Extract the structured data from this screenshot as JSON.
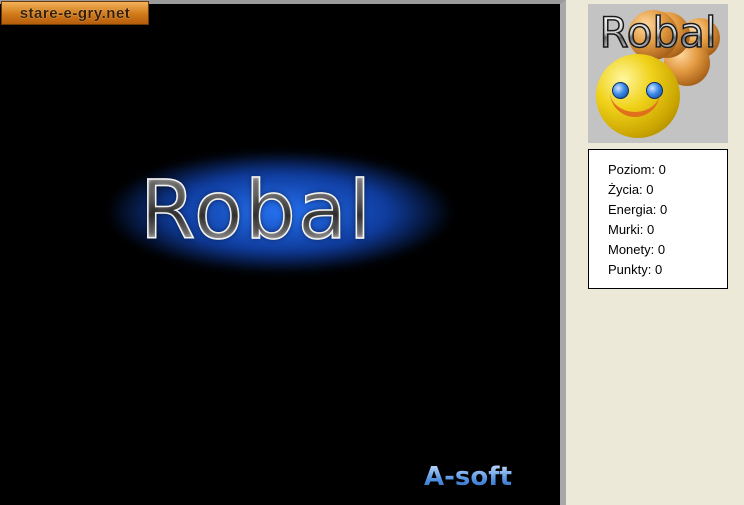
{
  "watermark": {
    "text": "stare-e-gry.net"
  },
  "title_screen": {
    "title": "Robal",
    "publisher": "A-soft"
  },
  "logo": {
    "text": "Robal",
    "mascot": "smiley-worm-icon"
  },
  "stats": [
    {
      "label": "Poziom:",
      "value": "0"
    },
    {
      "label": "Życia:",
      "value": "0"
    },
    {
      "label": "Energia:",
      "value": "0"
    },
    {
      "label": "Murki:",
      "value": "0"
    },
    {
      "label": "Monety:",
      "value": "0"
    },
    {
      "label": "Punkty:",
      "value": "0"
    }
  ],
  "colors": {
    "game_background": "#000000",
    "panel_background": "#ece9d8",
    "title_glow": "#2878ff",
    "publisher_text": "#7fb6ff",
    "watermark_bg": "#d17a1a"
  }
}
